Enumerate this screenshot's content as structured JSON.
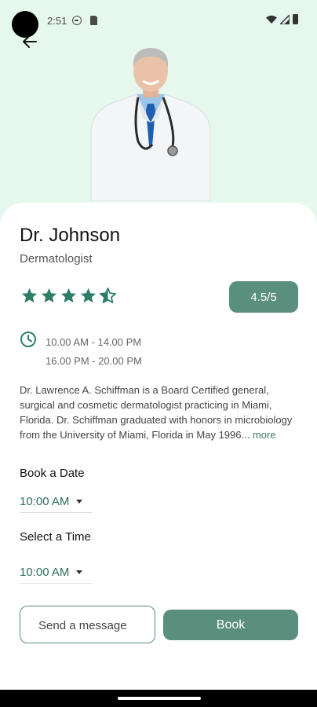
{
  "status_bar": {
    "time": "2:51",
    "icons": [
      "do-not-disturb-icon",
      "sd-card-icon",
      "wifi-icon",
      "signal-icon",
      "battery-icon"
    ]
  },
  "header": {
    "back_icon": "arrow-left-icon",
    "image_alt": "doctor-photo"
  },
  "doctor": {
    "name": "Dr. Johnson",
    "specialty": "Dermatologist",
    "rating": 4.5,
    "rating_label": "4.5/5",
    "hours": [
      "10.00 AM - 14.00 PM",
      "16.00 PM - 20.00 PM"
    ],
    "bio": "Dr. Lawrence A. Schiffman is a Board Certified general, surgical and cosmetic dermatologist practicing in Miami, Florida. Dr. Schiffman graduated with honors in microbiology from the University of Miami, Florida in May 1996...",
    "more_label": "more"
  },
  "booking": {
    "date_label": "Book a Date",
    "date_value": "10:00 AM",
    "time_label": "Select a Time",
    "time_value": "10:00 AM",
    "message_label": "Send a message",
    "book_label": "Book"
  },
  "colors": {
    "accent": "#5a8e7d",
    "star": "#2e7d68",
    "hero_bg": "#e6f8ee"
  }
}
